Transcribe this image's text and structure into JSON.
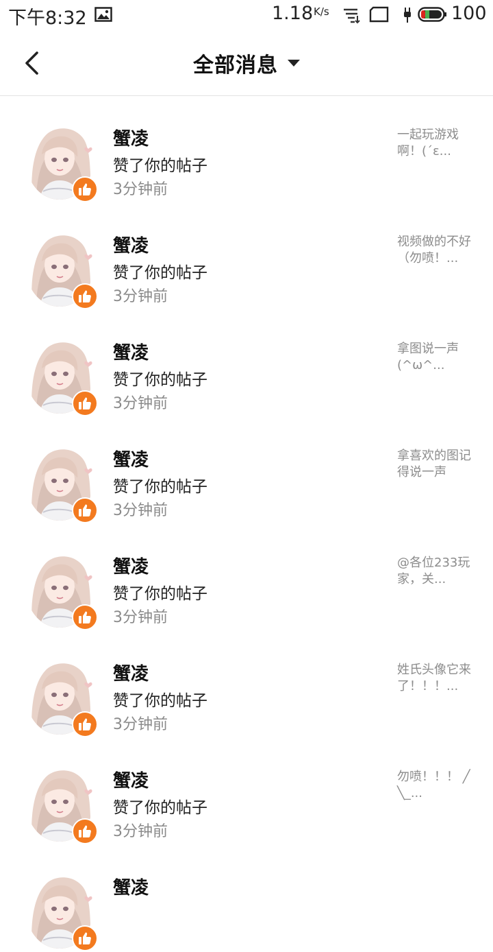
{
  "status_bar": {
    "time": "下午8:32",
    "speed": "1.18",
    "speed_unit": "K/s",
    "battery": "100",
    "icons": [
      "image-icon",
      "sync-icon",
      "sim-icon",
      "plug-icon",
      "battery-icon"
    ]
  },
  "header": {
    "back_icon": "chevron-left-icon",
    "title": "全部消息",
    "dropdown_icon": "caret-down-icon"
  },
  "colors": {
    "accent": "#f37a1f",
    "secondary_text": "#8a8a8a",
    "divider": "#e3e3e3"
  },
  "messages": [
    {
      "user": "蟹凌",
      "action": "赞了你的帖子",
      "time": "3分钟前",
      "preview": "一起玩游戏啊！(´ε..."
    },
    {
      "user": "蟹凌",
      "action": "赞了你的帖子",
      "time": "3分钟前",
      "preview": "视频做的不好（勿喷！..."
    },
    {
      "user": "蟹凌",
      "action": "赞了你的帖子",
      "time": "3分钟前",
      "preview": "拿图说一声(^ω^..."
    },
    {
      "user": "蟹凌",
      "action": "赞了你的帖子",
      "time": "3分钟前",
      "preview": "拿喜欢的图记得说一声"
    },
    {
      "user": "蟹凌",
      "action": "赞了你的帖子",
      "time": "3分钟前",
      "preview": "@各位233玩家，关..."
    },
    {
      "user": "蟹凌",
      "action": "赞了你的帖子",
      "time": "3分钟前",
      "preview": "姓氏头像它来了！！！..."
    },
    {
      "user": "蟹凌",
      "action": "赞了你的帖子",
      "time": "3分钟前",
      "preview": "勿喷！！！ ╱╲_..."
    },
    {
      "user": "蟹凌",
      "action": "",
      "time": "",
      "preview": ""
    }
  ]
}
